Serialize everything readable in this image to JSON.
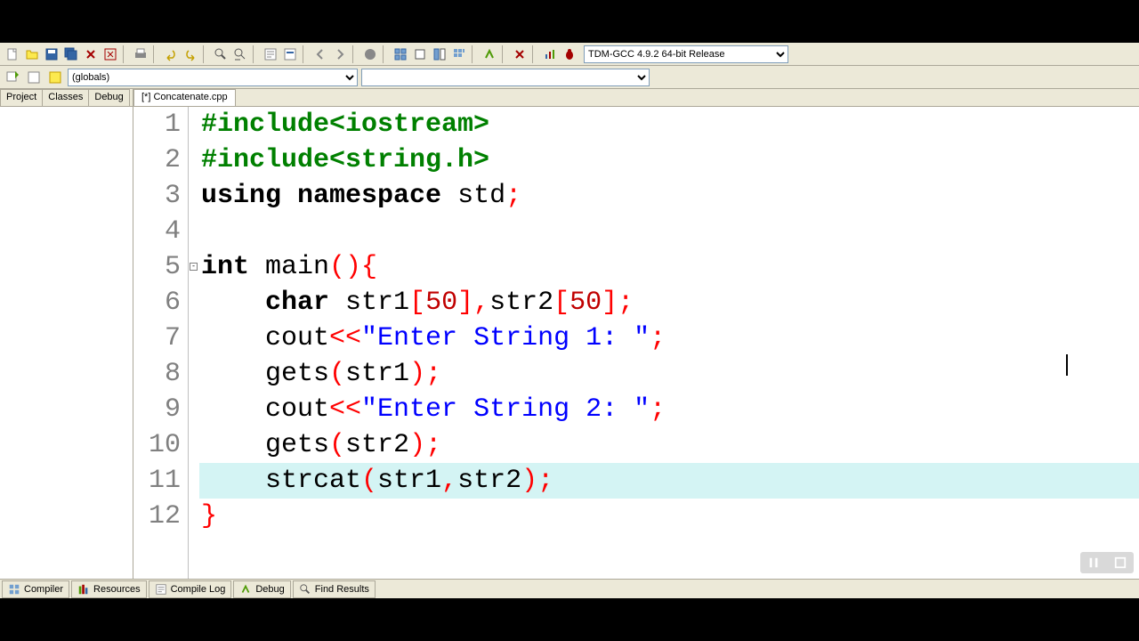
{
  "toolbar": {
    "compiler_combo": "TDM-GCC 4.9.2 64-bit Release"
  },
  "row2": {
    "globals_combo": "(globals)"
  },
  "left_tabs": [
    "Project",
    "Classes",
    "Debug"
  ],
  "editor": {
    "tab_label": "[*] Concatenate.cpp",
    "highlighted_line": 11,
    "lines": [
      {
        "n": 1,
        "tokens": [
          [
            "pp",
            "#include<iostream>"
          ]
        ]
      },
      {
        "n": 2,
        "tokens": [
          [
            "pp",
            "#include<string.h>"
          ]
        ]
      },
      {
        "n": 3,
        "tokens": [
          [
            "kw",
            "using"
          ],
          [
            "ident",
            " "
          ],
          [
            "kw",
            "namespace"
          ],
          [
            "ident",
            " std"
          ],
          [
            "op",
            ";"
          ]
        ]
      },
      {
        "n": 4,
        "tokens": []
      },
      {
        "n": 5,
        "fold": true,
        "tokens": [
          [
            "kw",
            "int"
          ],
          [
            "ident",
            " main"
          ],
          [
            "paren",
            "()"
          ],
          [
            "paren",
            "{"
          ]
        ]
      },
      {
        "n": 6,
        "tokens": [
          [
            "ident",
            "    "
          ],
          [
            "kw",
            "char"
          ],
          [
            "ident",
            " str1"
          ],
          [
            "paren",
            "["
          ],
          [
            "num",
            "50"
          ],
          [
            "paren",
            "]"
          ],
          [
            "op",
            ","
          ],
          [
            "ident",
            "str2"
          ],
          [
            "paren",
            "["
          ],
          [
            "num",
            "50"
          ],
          [
            "paren",
            "]"
          ],
          [
            "op",
            ";"
          ]
        ]
      },
      {
        "n": 7,
        "tokens": [
          [
            "ident",
            "    cout"
          ],
          [
            "op",
            "<<"
          ],
          [
            "str",
            "\"Enter String 1: \""
          ],
          [
            "op",
            ";"
          ]
        ]
      },
      {
        "n": 8,
        "tokens": [
          [
            "ident",
            "    gets"
          ],
          [
            "paren",
            "("
          ],
          [
            "ident",
            "str1"
          ],
          [
            "paren",
            ")"
          ],
          [
            "op",
            ";"
          ]
        ]
      },
      {
        "n": 9,
        "tokens": [
          [
            "ident",
            "    cout"
          ],
          [
            "op",
            "<<"
          ],
          [
            "str",
            "\"Enter String 2: \""
          ],
          [
            "op",
            ";"
          ]
        ]
      },
      {
        "n": 10,
        "tokens": [
          [
            "ident",
            "    gets"
          ],
          [
            "paren",
            "("
          ],
          [
            "ident",
            "str2"
          ],
          [
            "paren",
            ")"
          ],
          [
            "op",
            ";"
          ]
        ]
      },
      {
        "n": 11,
        "tokens": [
          [
            "ident",
            "    strcat"
          ],
          [
            "paren",
            "("
          ],
          [
            "ident",
            "str1"
          ],
          [
            "op",
            ","
          ],
          [
            "ident",
            "str2"
          ],
          [
            "paren",
            ")"
          ],
          [
            "op",
            ";"
          ]
        ]
      },
      {
        "n": 12,
        "tokens": [
          [
            "paren",
            "}"
          ]
        ]
      }
    ]
  },
  "bottom_tabs": [
    {
      "icon": "compiler",
      "label": "Compiler"
    },
    {
      "icon": "resources",
      "label": "Resources"
    },
    {
      "icon": "log",
      "label": "Compile Log"
    },
    {
      "icon": "debug",
      "label": "Debug"
    },
    {
      "icon": "find",
      "label": "Find Results"
    }
  ]
}
